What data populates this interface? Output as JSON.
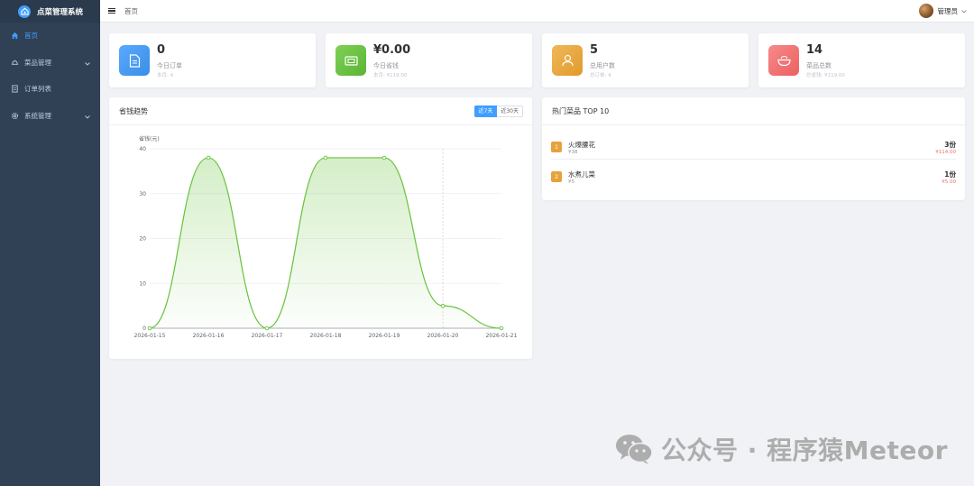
{
  "brand": {
    "title": "点菜管理系统"
  },
  "sidebar": {
    "items": [
      {
        "label": "首页",
        "icon": "home-icon",
        "active": true,
        "has_children": false
      },
      {
        "label": "菜品管理",
        "icon": "dish-icon",
        "active": false,
        "has_children": true
      },
      {
        "label": "订单列表",
        "icon": "document-icon",
        "active": false,
        "has_children": false
      },
      {
        "label": "系统管理",
        "icon": "gear-icon",
        "active": false,
        "has_children": true
      }
    ]
  },
  "header": {
    "breadcrumb": "首页",
    "username": "管理员"
  },
  "stats": [
    {
      "value": "0",
      "label": "今日订单",
      "sub": "本月: 4",
      "icon": "order-doc-icon",
      "color": "#409eff"
    },
    {
      "value": "¥0.00",
      "label": "今日省钱",
      "sub": "本月: ¥119.00",
      "icon": "money-icon",
      "color": "#67c23a"
    },
    {
      "value": "5",
      "label": "总用户数",
      "sub": "总订单: 4",
      "icon": "user-icon",
      "color": "#e6a23c"
    },
    {
      "value": "14",
      "label": "菜品总数",
      "sub": "总省钱: ¥119.00",
      "icon": "bowl-icon",
      "color": "#f56c6c"
    }
  ],
  "trend": {
    "title": "省钱趋势",
    "range_options": [
      "近7天",
      "近30天"
    ],
    "selected_range": "近7天"
  },
  "chart_data": {
    "type": "area",
    "title": "",
    "xlabel": "",
    "ylabel": "省钱(元)",
    "x": [
      "2026-01-15",
      "2026-01-16",
      "2026-01-17",
      "2026-01-18",
      "2026-01-19",
      "2026-01-20",
      "2026-01-21"
    ],
    "series": [
      {
        "name": "",
        "values": [
          0,
          38,
          0,
          38,
          38,
          5,
          0
        ]
      }
    ],
    "ylim": [
      0,
      40
    ],
    "yticks": [
      0,
      10,
      20,
      30,
      40
    ],
    "grid": true,
    "color": "#67c23a"
  },
  "top10": {
    "title": "热门菜品 TOP 10",
    "items": [
      {
        "rank": "1",
        "name": "火爆腰花",
        "price": "¥38",
        "qty": "3份",
        "amount": "¥114.00"
      },
      {
        "rank": "2",
        "name": "水煮儿菜",
        "price": "¥5",
        "qty": "1份",
        "amount": "¥5.00"
      }
    ]
  },
  "watermark": {
    "text": "公众号 · 程序猿Meteor"
  }
}
